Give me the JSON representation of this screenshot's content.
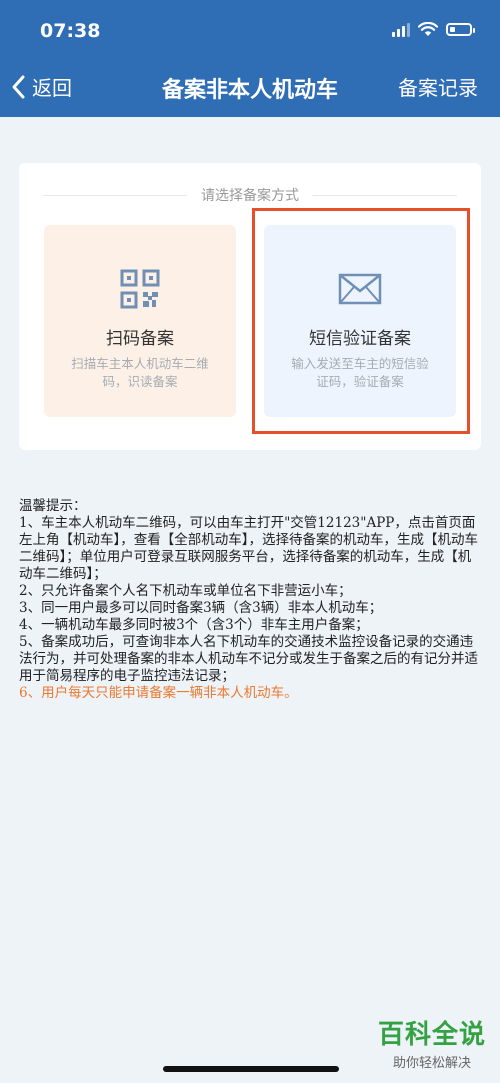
{
  "status_bar": {
    "time": "07:38"
  },
  "nav": {
    "back_label": "返回",
    "title": "备案非本人机动车",
    "right_label": "备案记录"
  },
  "method": {
    "prompt": "请选择备案方式",
    "options": [
      {
        "title": "扫码备案",
        "desc": "扫描车主本人机动车二维码，识读备案"
      },
      {
        "title": "短信验证备案",
        "desc": "输入发送至车主的短信验证码，验证备案"
      }
    ]
  },
  "tips": {
    "heading": "温馨提示：",
    "items": [
      "1、车主本人机动车二维码，可以由车主打开\"交管12123\"APP，点击首页面左上角【机动车】，查看【全部机动车】，选择待备案的机动车，生成【机动车二维码】；单位用户可登录互联网服务平台，选择待备案的机动车，生成【机动车二维码】；",
      "2、只允许备案个人名下机动车或单位名下非营运小车；",
      "3、同一用户最多可以同时备案3辆（含3辆）非本人机动车；",
      "4、一辆机动车最多同时被3个（含3个）非车主用户备案；",
      "5、备案成功后，可查询非本人名下机动车的交通技术监控设备记录的交通违法行为，并可处理备案的非本人机动车不记分或发生于备案之后的有记分并适用于简易程序的电子监控违法记录；",
      "6、用户每天只能申请备案一辆非本人机动车。"
    ]
  },
  "watermark": {
    "main": "百科全说",
    "sub": "助你轻松解决"
  },
  "colors": {
    "header": "#2f6db5",
    "highlight": "#e5502a",
    "tip_highlight": "#ea7a2f",
    "watermark": "#34a243"
  }
}
